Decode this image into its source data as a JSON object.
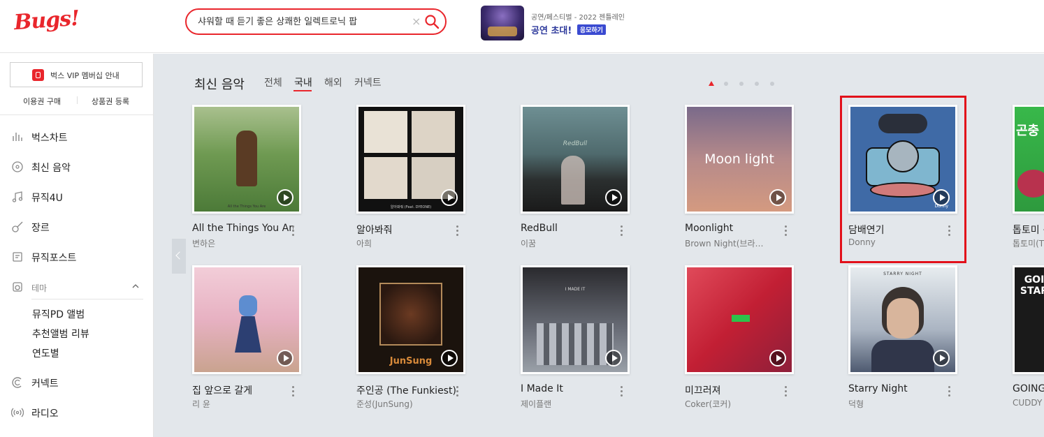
{
  "header": {
    "logo": "Bugs!",
    "search_value": "샤워할 때 듣기 좋은 상쾌한 일렉트로닉 팝",
    "clear_symbol": "×",
    "promo_small": "공연/페스티벌 - 2022 젠틀레인",
    "promo_big": "공연 초대!",
    "promo_badge": "응모하기"
  },
  "sidebar": {
    "vip_label": "벅스 VIP 멤버십 안내",
    "buy_pass": "이용권 구매",
    "register_coupon": "상품권 등록",
    "menu": [
      {
        "label": "벅스차트",
        "icon": "chart-icon"
      },
      {
        "label": "최신 음악",
        "icon": "new-music-icon"
      },
      {
        "label": "뮤직4U",
        "icon": "music-note-icon"
      },
      {
        "label": "장르",
        "icon": "guitar-icon"
      },
      {
        "label": "뮤직포스트",
        "icon": "post-icon"
      },
      {
        "label": "테마",
        "icon": "theme-icon"
      }
    ],
    "theme_sub": [
      "뮤직PD 앨범",
      "추천앨범 리뷰",
      "연도별"
    ],
    "menu_bottom": [
      {
        "label": "커넥트",
        "icon": "connect-icon"
      },
      {
        "label": "라디오",
        "icon": "radio-icon"
      }
    ]
  },
  "main": {
    "section_title": "최신 음악",
    "tabs": [
      "전체",
      "국내",
      "해외",
      "커넥트"
    ],
    "active_tab": "국내",
    "pagination_pages": 5,
    "pagination_active": 1,
    "albums_row1": [
      {
        "title": "All the Things You Are",
        "artist": "변하은",
        "cover_text": "All the Things You Are"
      },
      {
        "title": "알아봐줘",
        "artist": "아희",
        "cover_text": "알아봐줘 (Feat. DYEONE)"
      },
      {
        "title": "RedBull",
        "artist": "이꿈",
        "cover_text": "RedBull"
      },
      {
        "title": "Moonlight",
        "artist": "Brown Night(브라…",
        "cover_text": "Moon light"
      },
      {
        "title": "담배연기",
        "artist": "Donny",
        "cover_text": "Donny"
      },
      {
        "title": "톱토미 ·",
        "artist": "톱토미(T",
        "cover_text": "곤충"
      }
    ],
    "albums_row2": [
      {
        "title": "집 앞으로 갈게",
        "artist": "리 윤",
        "cover_text": ""
      },
      {
        "title": "주인공 (The Funkiest)",
        "artist": "준성(JunSung)",
        "cover_text": "JunSung"
      },
      {
        "title": "I Made It",
        "artist": "제이플랜",
        "cover_text": "I MADE IT"
      },
      {
        "title": "미끄러져",
        "artist": "Coker(코커)",
        "cover_text": ""
      },
      {
        "title": "Starry Night",
        "artist": "덕형",
        "cover_text": "STARRY NIGHT"
      },
      {
        "title": "GOING",
        "artist": "CUDDY",
        "cover_text": "GOI STAR"
      }
    ]
  },
  "colors": {
    "brand": "#e9262c",
    "main_bg": "#e3e7eb",
    "highlight": "#e2101a"
  }
}
